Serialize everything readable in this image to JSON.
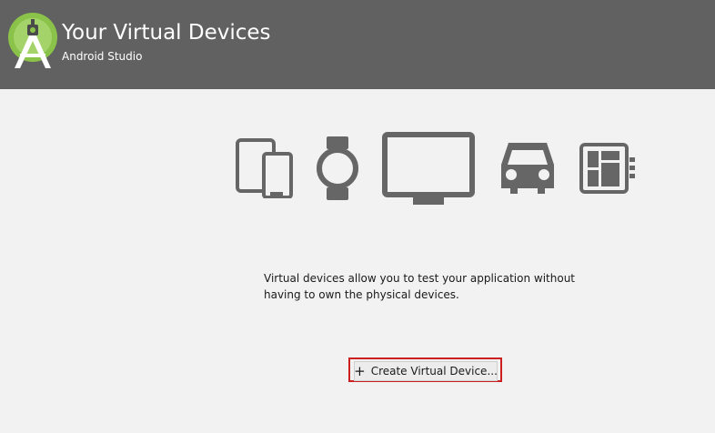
{
  "header": {
    "title": "Your Virtual Devices",
    "subtitle": "Android Studio"
  },
  "icons": [
    "phone-tablet-icon",
    "watch-icon",
    "tv-icon",
    "car-icon",
    "things-icon"
  ],
  "main": {
    "description": "Virtual devices allow you to test your application without having to own the physical devices.",
    "create_button": {
      "icon": "+",
      "label": "Create Virtual Device..."
    }
  },
  "colors": {
    "header_bg": "#616161",
    "background": "#f2f2f2",
    "icon_gray": "#666666",
    "logo_green": "#8bc34a",
    "focus_outline": "#cc1f1f"
  }
}
